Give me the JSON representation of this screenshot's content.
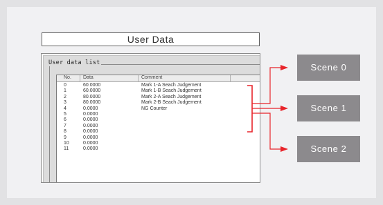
{
  "title": "User Data",
  "group_caption": "User data list",
  "columns": [
    "No.",
    "Data",
    "Comment"
  ],
  "rows": [
    {
      "no": "0",
      "data": "60.0000",
      "comment": "Mark 1-A Seach Judgement"
    },
    {
      "no": "1",
      "data": "60.0000",
      "comment": "Mark 1-B Seach Judgement"
    },
    {
      "no": "2",
      "data": "80.0000",
      "comment": "Mark 2-A Seach Judgement"
    },
    {
      "no": "3",
      "data": "80.0000",
      "comment": "Mark 2-B Seach Judgement"
    },
    {
      "no": "4",
      "data": "0.0000",
      "comment": "NG Counter"
    },
    {
      "no": "5",
      "data": "0.0000",
      "comment": ""
    },
    {
      "no": "6",
      "data": "0.0000",
      "comment": ""
    },
    {
      "no": "7",
      "data": "0.0000",
      "comment": ""
    },
    {
      "no": "8",
      "data": "0.0000",
      "comment": ""
    },
    {
      "no": "9",
      "data": "0.0000",
      "comment": ""
    },
    {
      "no": "10",
      "data": "0.0000",
      "comment": ""
    },
    {
      "no": "11",
      "data": "0.0000",
      "comment": ""
    }
  ],
  "scenes": [
    "Scene 0",
    "Scene 1",
    "Scene 2"
  ],
  "colors": {
    "background": "#e2e2e4",
    "panel": "#f1f1f3",
    "scene_box": "#8c8a8d",
    "arrow": "#e8242a",
    "bracket": "#e8242a"
  }
}
